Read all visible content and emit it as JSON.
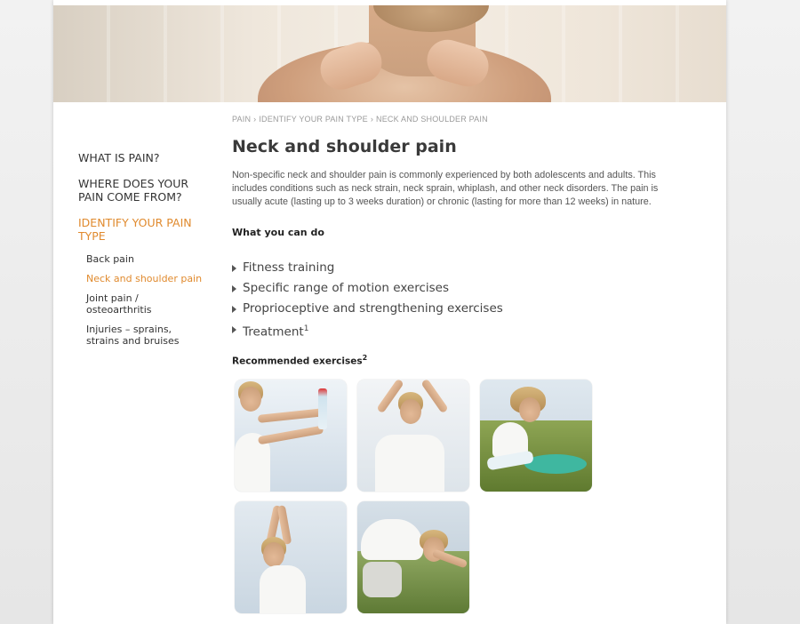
{
  "breadcrumb": {
    "items": [
      "PAIN",
      "IDENTIFY YOUR PAIN TYPE",
      "NECK AND SHOULDER PAIN"
    ],
    "separator": "›"
  },
  "sidebar": {
    "main_items": [
      {
        "label": "WHAT IS PAIN?",
        "active": false
      },
      {
        "label": "WHERE DOES YOUR PAIN COME FROM?",
        "active": false
      },
      {
        "label": "IDENTIFY YOUR PAIN TYPE",
        "active": true
      }
    ],
    "sub_items": [
      {
        "label": "Back pain",
        "active": false
      },
      {
        "label": "Neck and shoulder pain",
        "active": true
      },
      {
        "label": "Joint pain / osteoarthritis",
        "active": false
      },
      {
        "label": "Injuries – sprains, strains and bruises",
        "active": false
      }
    ]
  },
  "main": {
    "title": "Neck and shoulder pain",
    "intro": "Non-specific neck and shoulder pain is commonly experienced by both adolescents and adults. This includes conditions such as neck strain, neck sprain, whiplash, and other neck disorders. The pain is usually acute (lasting up to 3 weeks duration) or chronic (lasting for more than 12 weeks) in nature.",
    "what_you_can_do": "What you can do",
    "actions": [
      {
        "label": "Fitness training",
        "sup": ""
      },
      {
        "label": "Specific range of motion exercises",
        "sup": ""
      },
      {
        "label": "Proprioceptive and strengthening exercises",
        "sup": ""
      },
      {
        "label": "Treatment",
        "sup": "1"
      }
    ],
    "recommended_label": "Recommended exercises",
    "recommended_sup": "2",
    "exercises": [
      "exercise-1",
      "exercise-2",
      "exercise-3",
      "exercise-4",
      "exercise-5"
    ]
  },
  "colors": {
    "accent": "#e08a2e",
    "text": "#333333",
    "muted": "#9a9a9a"
  }
}
